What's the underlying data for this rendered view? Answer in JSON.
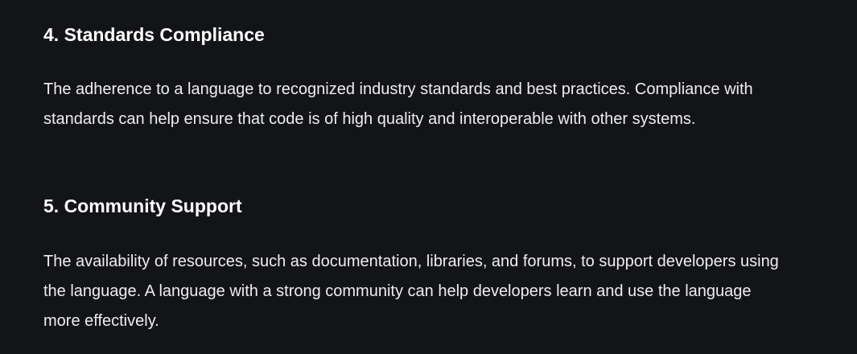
{
  "sections": [
    {
      "heading": "4. Standards Compliance",
      "body": "The adherence to a language to recognized industry standards and best practices. Compliance with standards can help ensure that code is of high quality and interoperable with other systems."
    },
    {
      "heading": "5. Community Support",
      "body": "The availability of resources, such as documentation, libraries, and forums, to support developers using the language. A language with a strong community can help developers learn and use the language more effectively."
    }
  ],
  "colors": {
    "background": "#131417",
    "heading_text": "#ffffff",
    "body_text": "#eeeef0"
  }
}
